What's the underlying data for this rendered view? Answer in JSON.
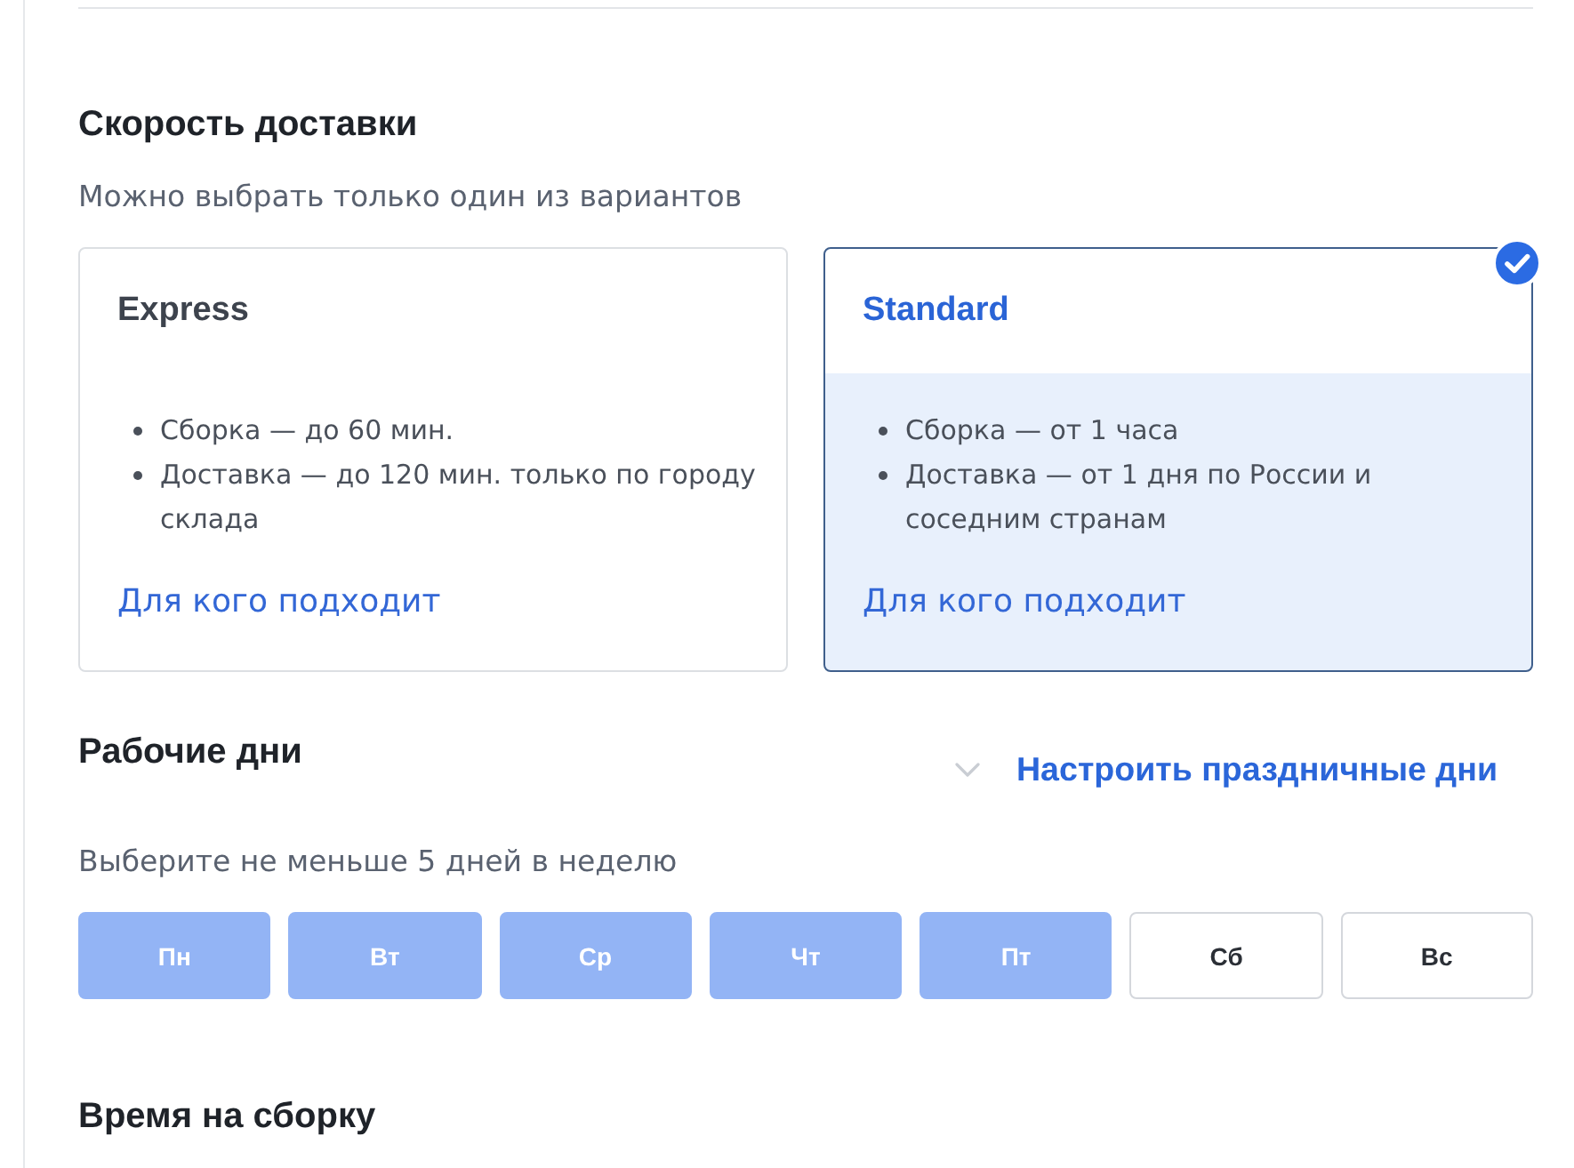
{
  "delivery_speed": {
    "title": "Скорость доставки",
    "hint": "Можно выбрать только один из вариантов",
    "options": [
      {
        "name": "Express",
        "selected": false,
        "features": [
          "Сборка — до 60 мин.",
          "Доставка — до 120 мин. только по городу склада"
        ],
        "link": "Для кого подходит"
      },
      {
        "name": "Standard",
        "selected": true,
        "features": [
          "Сборка — от 1 часа",
          "Доставка — от 1 дня по России и соседним странам"
        ],
        "link": "Для кого подходит"
      }
    ]
  },
  "working_days": {
    "title": "Рабочие дни",
    "holidays_link": "Настроить праздничные дни",
    "hint": "Выберите не меньше 5 дней в неделю",
    "days": [
      {
        "label": "Пн",
        "selected": true
      },
      {
        "label": "Вт",
        "selected": true
      },
      {
        "label": "Ср",
        "selected": true
      },
      {
        "label": "Чт",
        "selected": true
      },
      {
        "label": "Пт",
        "selected": true
      },
      {
        "label": "Сб",
        "selected": false
      },
      {
        "label": "Вс",
        "selected": false
      }
    ]
  },
  "assembly_time": {
    "title": "Время на сборку"
  }
}
